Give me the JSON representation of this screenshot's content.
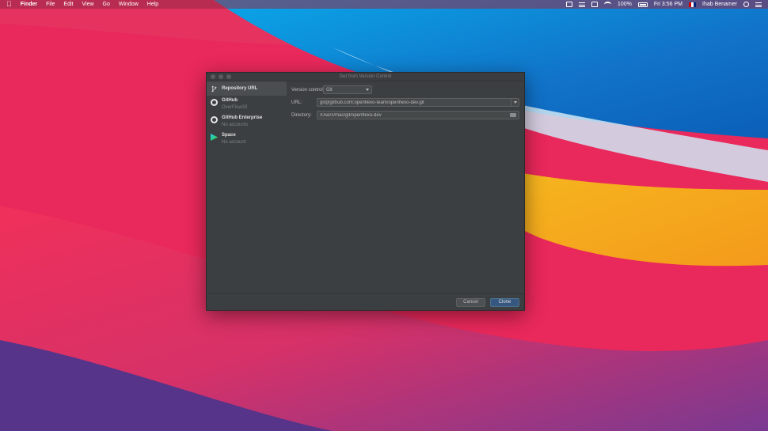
{
  "menubar": {
    "app_name": "Finder",
    "menus": [
      "File",
      "Edit",
      "View",
      "Go",
      "Window",
      "Help"
    ],
    "battery_text": "100%",
    "clock": "Fri 3:56 PM",
    "user": "Ihab Benamer"
  },
  "dialog": {
    "title": "Get from Version Control",
    "sidebar": [
      {
        "label": "Repository URL",
        "sub": "",
        "icon": "branch-icon"
      },
      {
        "label": "GitHub",
        "sub": "OverFlow33",
        "icon": "github-icon"
      },
      {
        "label": "GitHub Enterprise",
        "sub": "No accounts",
        "icon": "github-icon"
      },
      {
        "label": "Space",
        "sub": "No account",
        "icon": "space-icon"
      }
    ],
    "version_control_label": "Version control:",
    "version_control_value": "Git",
    "url_label": "URL:",
    "url_value": "git@github.com:openflexo-team/openflexo-dev.git",
    "directory_label": "Directory:",
    "directory_value": "/Users/mac/git/openflexo-dev",
    "cancel_label": "Cancel",
    "clone_label": "Clone"
  }
}
